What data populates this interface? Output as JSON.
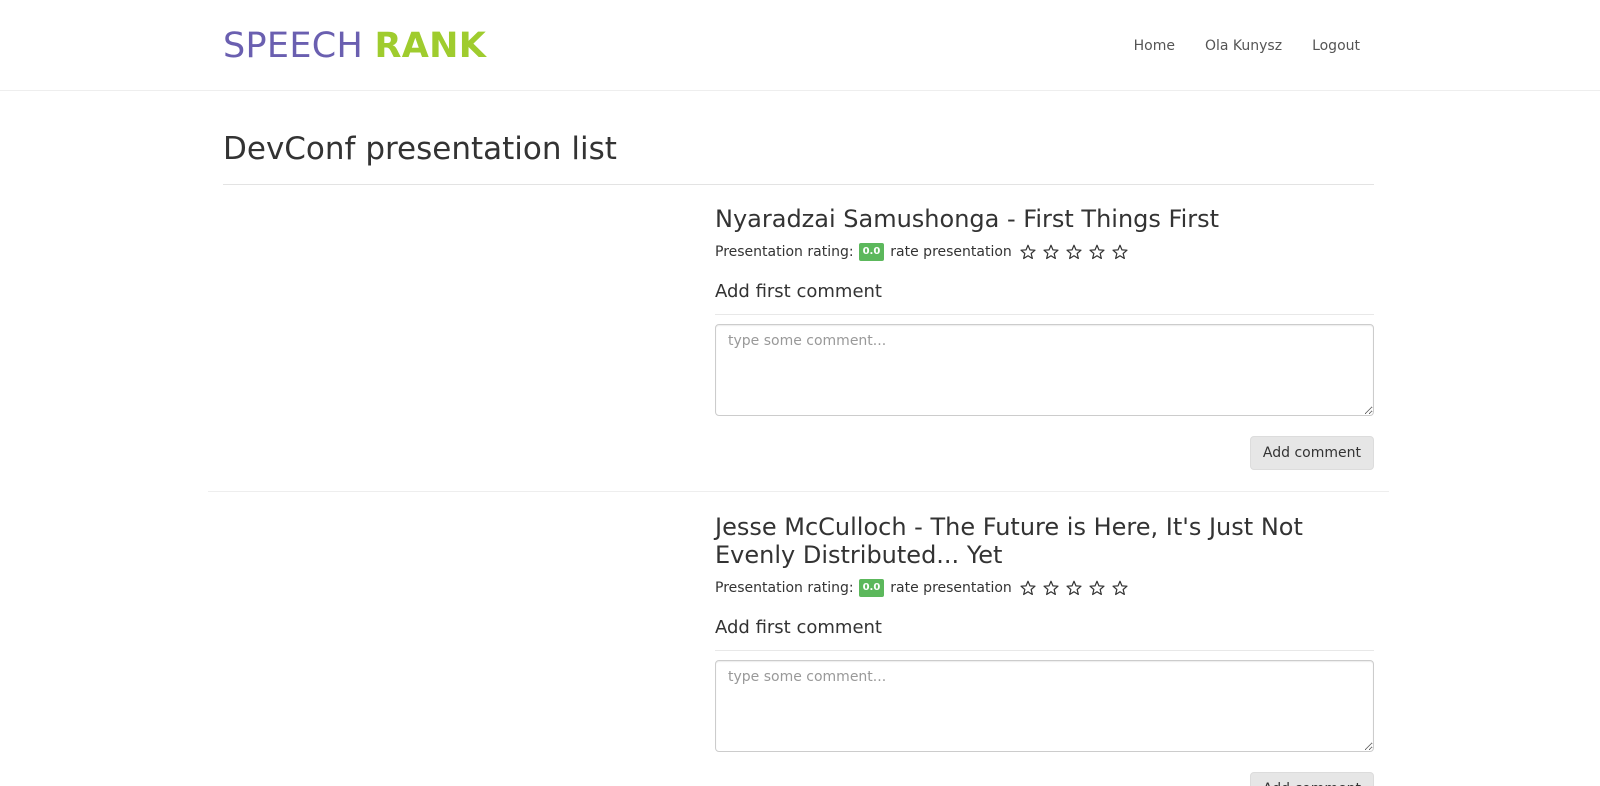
{
  "brand": {
    "part1": "SPEECH",
    "part2": "RANK"
  },
  "nav": {
    "home": "Home",
    "user": "Ola Kunysz",
    "logout": "Logout"
  },
  "page": {
    "title": "DevConf presentation list"
  },
  "presentations": [
    {
      "title": "Nyaradzai Samushonga - First Things First",
      "rating_label": "Presentation rating:",
      "rating_value": "0.0",
      "rate_label": "rate presentation",
      "stars_max": 5,
      "stars_selected": 0,
      "comment_heading": "Add first comment",
      "comment_placeholder": "type some comment...",
      "comment_value": "",
      "button_label": "Add comment"
    },
    {
      "title": "Jesse McCulloch - The Future is Here, It's Just Not Evenly Distributed... Yet",
      "rating_label": "Presentation rating:",
      "rating_value": "0.0",
      "rate_label": "rate presentation",
      "stars_max": 5,
      "stars_selected": 0,
      "comment_heading": "Add first comment",
      "comment_placeholder": "type some comment...",
      "comment_value": "",
      "button_label": "Add comment"
    }
  ],
  "colors": {
    "brand_primary": "#6a5fb0",
    "brand_accent": "#9fcc2e",
    "rating_badge": "#5cb85c",
    "button_bg": "#e6e6e6"
  },
  "icons": {
    "rating_star": "star-outline-icon"
  }
}
